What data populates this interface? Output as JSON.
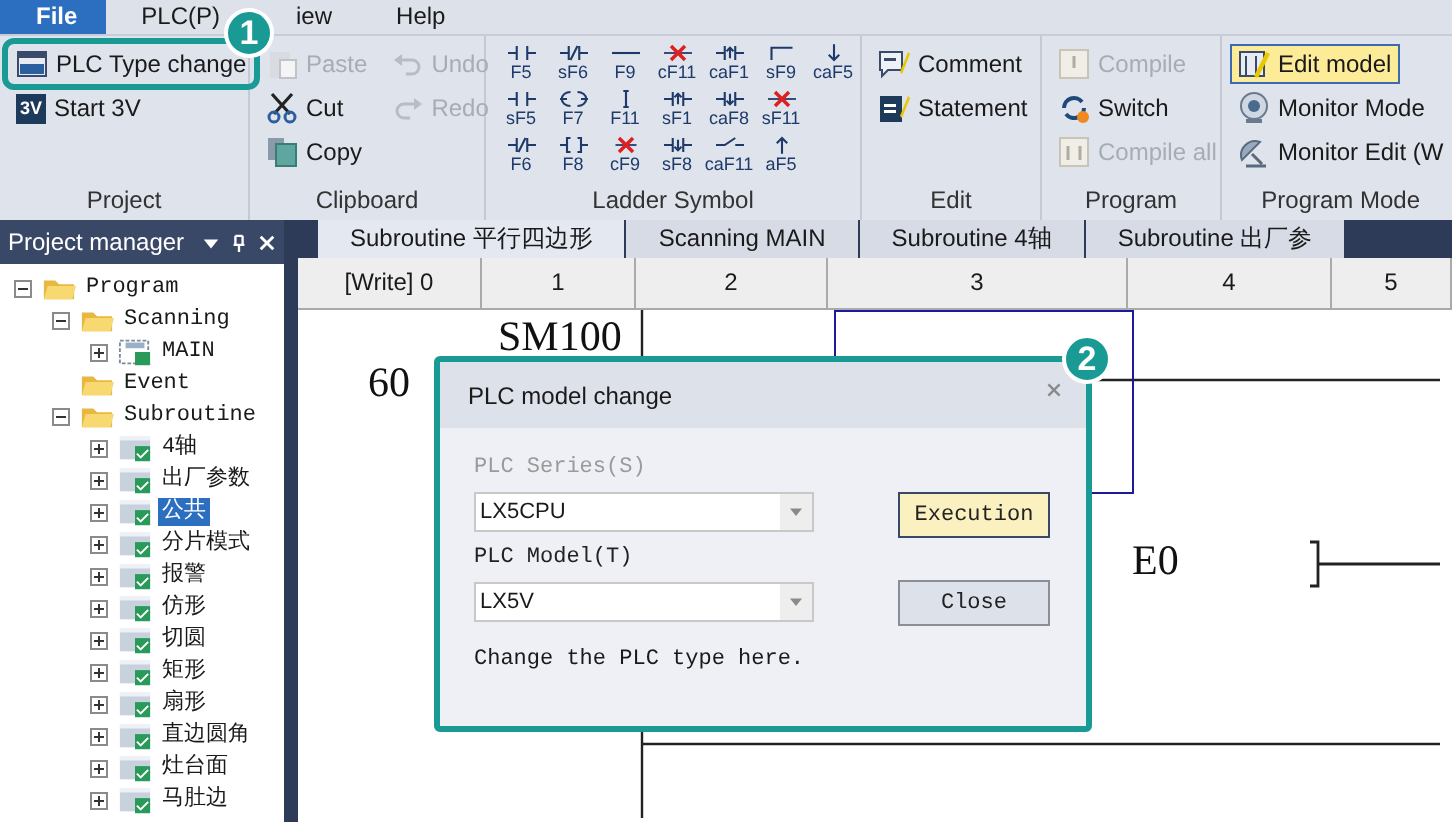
{
  "menu": [
    {
      "label": "File",
      "selected": true
    },
    {
      "label": "PLC(P)",
      "selected": false
    },
    {
      "label": "iew",
      "selected": false
    },
    {
      "label": "Help",
      "selected": false
    }
  ],
  "ribbon": {
    "groups": [
      {
        "label": "Project",
        "kind": "column",
        "items": [
          {
            "kind": "plc-type",
            "label": "PLC Type change",
            "disabled": false,
            "selected": false,
            "callout": "1"
          },
          {
            "kind": "start-3v",
            "label": "Start 3V",
            "icon_text": "3V",
            "disabled": false,
            "selected": false
          }
        ]
      },
      {
        "label": "Clipboard",
        "kind": "grid",
        "items": [
          {
            "kind": "paste",
            "label": "Paste",
            "disabled": true,
            "selected": false
          },
          {
            "kind": "undo",
            "label": "Undo",
            "disabled": true,
            "selected": false
          },
          {
            "kind": "cut",
            "label": "Cut",
            "disabled": false,
            "selected": false
          },
          {
            "kind": "redo",
            "label": "Redo",
            "disabled": true,
            "selected": false
          },
          {
            "kind": "copy",
            "label": "Copy",
            "disabled": false,
            "selected": false
          }
        ]
      },
      {
        "label": "Ladder Symbol",
        "kind": "symbols",
        "rows": [
          [
            {
              "kind": "contact-no",
              "label": "F5"
            },
            {
              "kind": "contact-nc",
              "label": "sF6"
            },
            {
              "kind": "hline",
              "label": "F9"
            },
            {
              "kind": "delete",
              "label": "cF11"
            },
            {
              "kind": "rise",
              "label": "caF1"
            },
            {
              "kind": "corner",
              "label": "sF9"
            },
            {
              "kind": "arrow-down",
              "label": "caF5"
            }
          ],
          [
            {
              "kind": "contact-no",
              "label": "sF5"
            },
            {
              "kind": "coil",
              "label": "F7"
            },
            {
              "kind": "vline",
              "label": "F11"
            },
            {
              "kind": "rise",
              "label": "sF1"
            },
            {
              "kind": "fall",
              "label": "caF8"
            },
            {
              "kind": "delete",
              "label": "sF11"
            }
          ],
          [
            {
              "kind": "contact-nc",
              "label": "F6"
            },
            {
              "kind": "func",
              "label": "F8"
            },
            {
              "kind": "delete-line",
              "label": "cF9"
            },
            {
              "kind": "fall",
              "label": "sF8"
            },
            {
              "kind": "invert",
              "label": "caF11"
            },
            {
              "kind": "arrow-up",
              "label": "aF5"
            }
          ]
        ]
      },
      {
        "label": "Edit",
        "kind": "column",
        "items": [
          {
            "kind": "comment",
            "label": "Comment",
            "disabled": false,
            "selected": false
          },
          {
            "kind": "statement",
            "label": "Statement",
            "disabled": false,
            "selected": false
          }
        ]
      },
      {
        "label": "Program",
        "kind": "column",
        "items": [
          {
            "kind": "compile",
            "label": "Compile",
            "disabled": true,
            "selected": false
          },
          {
            "kind": "switch",
            "label": "Switch",
            "disabled": false,
            "selected": false
          },
          {
            "kind": "compile-all",
            "label": "Compile all",
            "disabled": true,
            "selected": false
          }
        ]
      },
      {
        "label": "Program Mode",
        "kind": "column",
        "items": [
          {
            "kind": "edit-model",
            "label": "Edit model",
            "disabled": false,
            "selected": true
          },
          {
            "kind": "monitor",
            "label": "Monitor Mode",
            "disabled": false,
            "selected": false
          },
          {
            "kind": "monitor-edit",
            "label": "Monitor Edit (W",
            "disabled": false,
            "selected": false
          }
        ]
      }
    ]
  },
  "project_manager": {
    "title": "Project manager",
    "tree": [
      {
        "label": "Program",
        "kind": "folder",
        "expanded": true,
        "selected": false,
        "children": [
          {
            "label": "Scanning",
            "kind": "folder",
            "expanded": true,
            "selected": false,
            "children": [
              {
                "label": "MAIN",
                "kind": "program",
                "expanded": false,
                "selected": false
              }
            ]
          },
          {
            "label": "Event",
            "kind": "folder",
            "selected": false
          },
          {
            "label": "Subroutine",
            "kind": "folder",
            "expanded": true,
            "selected": false,
            "children": [
              {
                "label": "4轴",
                "kind": "sub",
                "expanded": false,
                "selected": false
              },
              {
                "label": "出厂参数",
                "kind": "sub",
                "expanded": false,
                "selected": false
              },
              {
                "label": "公共",
                "kind": "sub",
                "expanded": false,
                "selected": true
              },
              {
                "label": "分片模式",
                "kind": "sub",
                "expanded": false,
                "selected": false
              },
              {
                "label": "报警",
                "kind": "sub",
                "expanded": false,
                "selected": false
              },
              {
                "label": "仿形",
                "kind": "sub",
                "expanded": false,
                "selected": false
              },
              {
                "label": "切圆",
                "kind": "sub",
                "expanded": false,
                "selected": false
              },
              {
                "label": "矩形",
                "kind": "sub",
                "expanded": false,
                "selected": false
              },
              {
                "label": "扇形",
                "kind": "sub",
                "expanded": false,
                "selected": false
              },
              {
                "label": "直边圆角",
                "kind": "sub",
                "expanded": false,
                "selected": false
              },
              {
                "label": "灶台面",
                "kind": "sub",
                "expanded": false,
                "selected": false
              },
              {
                "label": "马肚边",
                "kind": "sub",
                "expanded": false,
                "selected": false
              }
            ]
          }
        ]
      }
    ]
  },
  "tabs": [
    {
      "label": "Subroutine 平行四边形",
      "selected": true
    },
    {
      "label": "Scanning MAIN",
      "selected": false
    },
    {
      "label": "Subroutine 4轴",
      "selected": false
    },
    {
      "label": "Subroutine 出厂参",
      "selected": false
    }
  ],
  "columns": [
    "[Write] 0",
    "1",
    "2",
    "3",
    "4",
    "5"
  ],
  "ladder": {
    "contact": "SM100",
    "step": "60",
    "coil": "E0"
  },
  "dialog": {
    "title": "PLC model change",
    "callout": "2",
    "series_label": "PLC Series(S)",
    "series_disabled": true,
    "series_value": "LX5CPU",
    "model_label": "PLC Model(T)",
    "model_value": "LX5V",
    "buttons": [
      {
        "label": "Execution",
        "default": true
      },
      {
        "label": "Close",
        "default": false
      }
    ],
    "hint": "Change the PLC type here."
  }
}
